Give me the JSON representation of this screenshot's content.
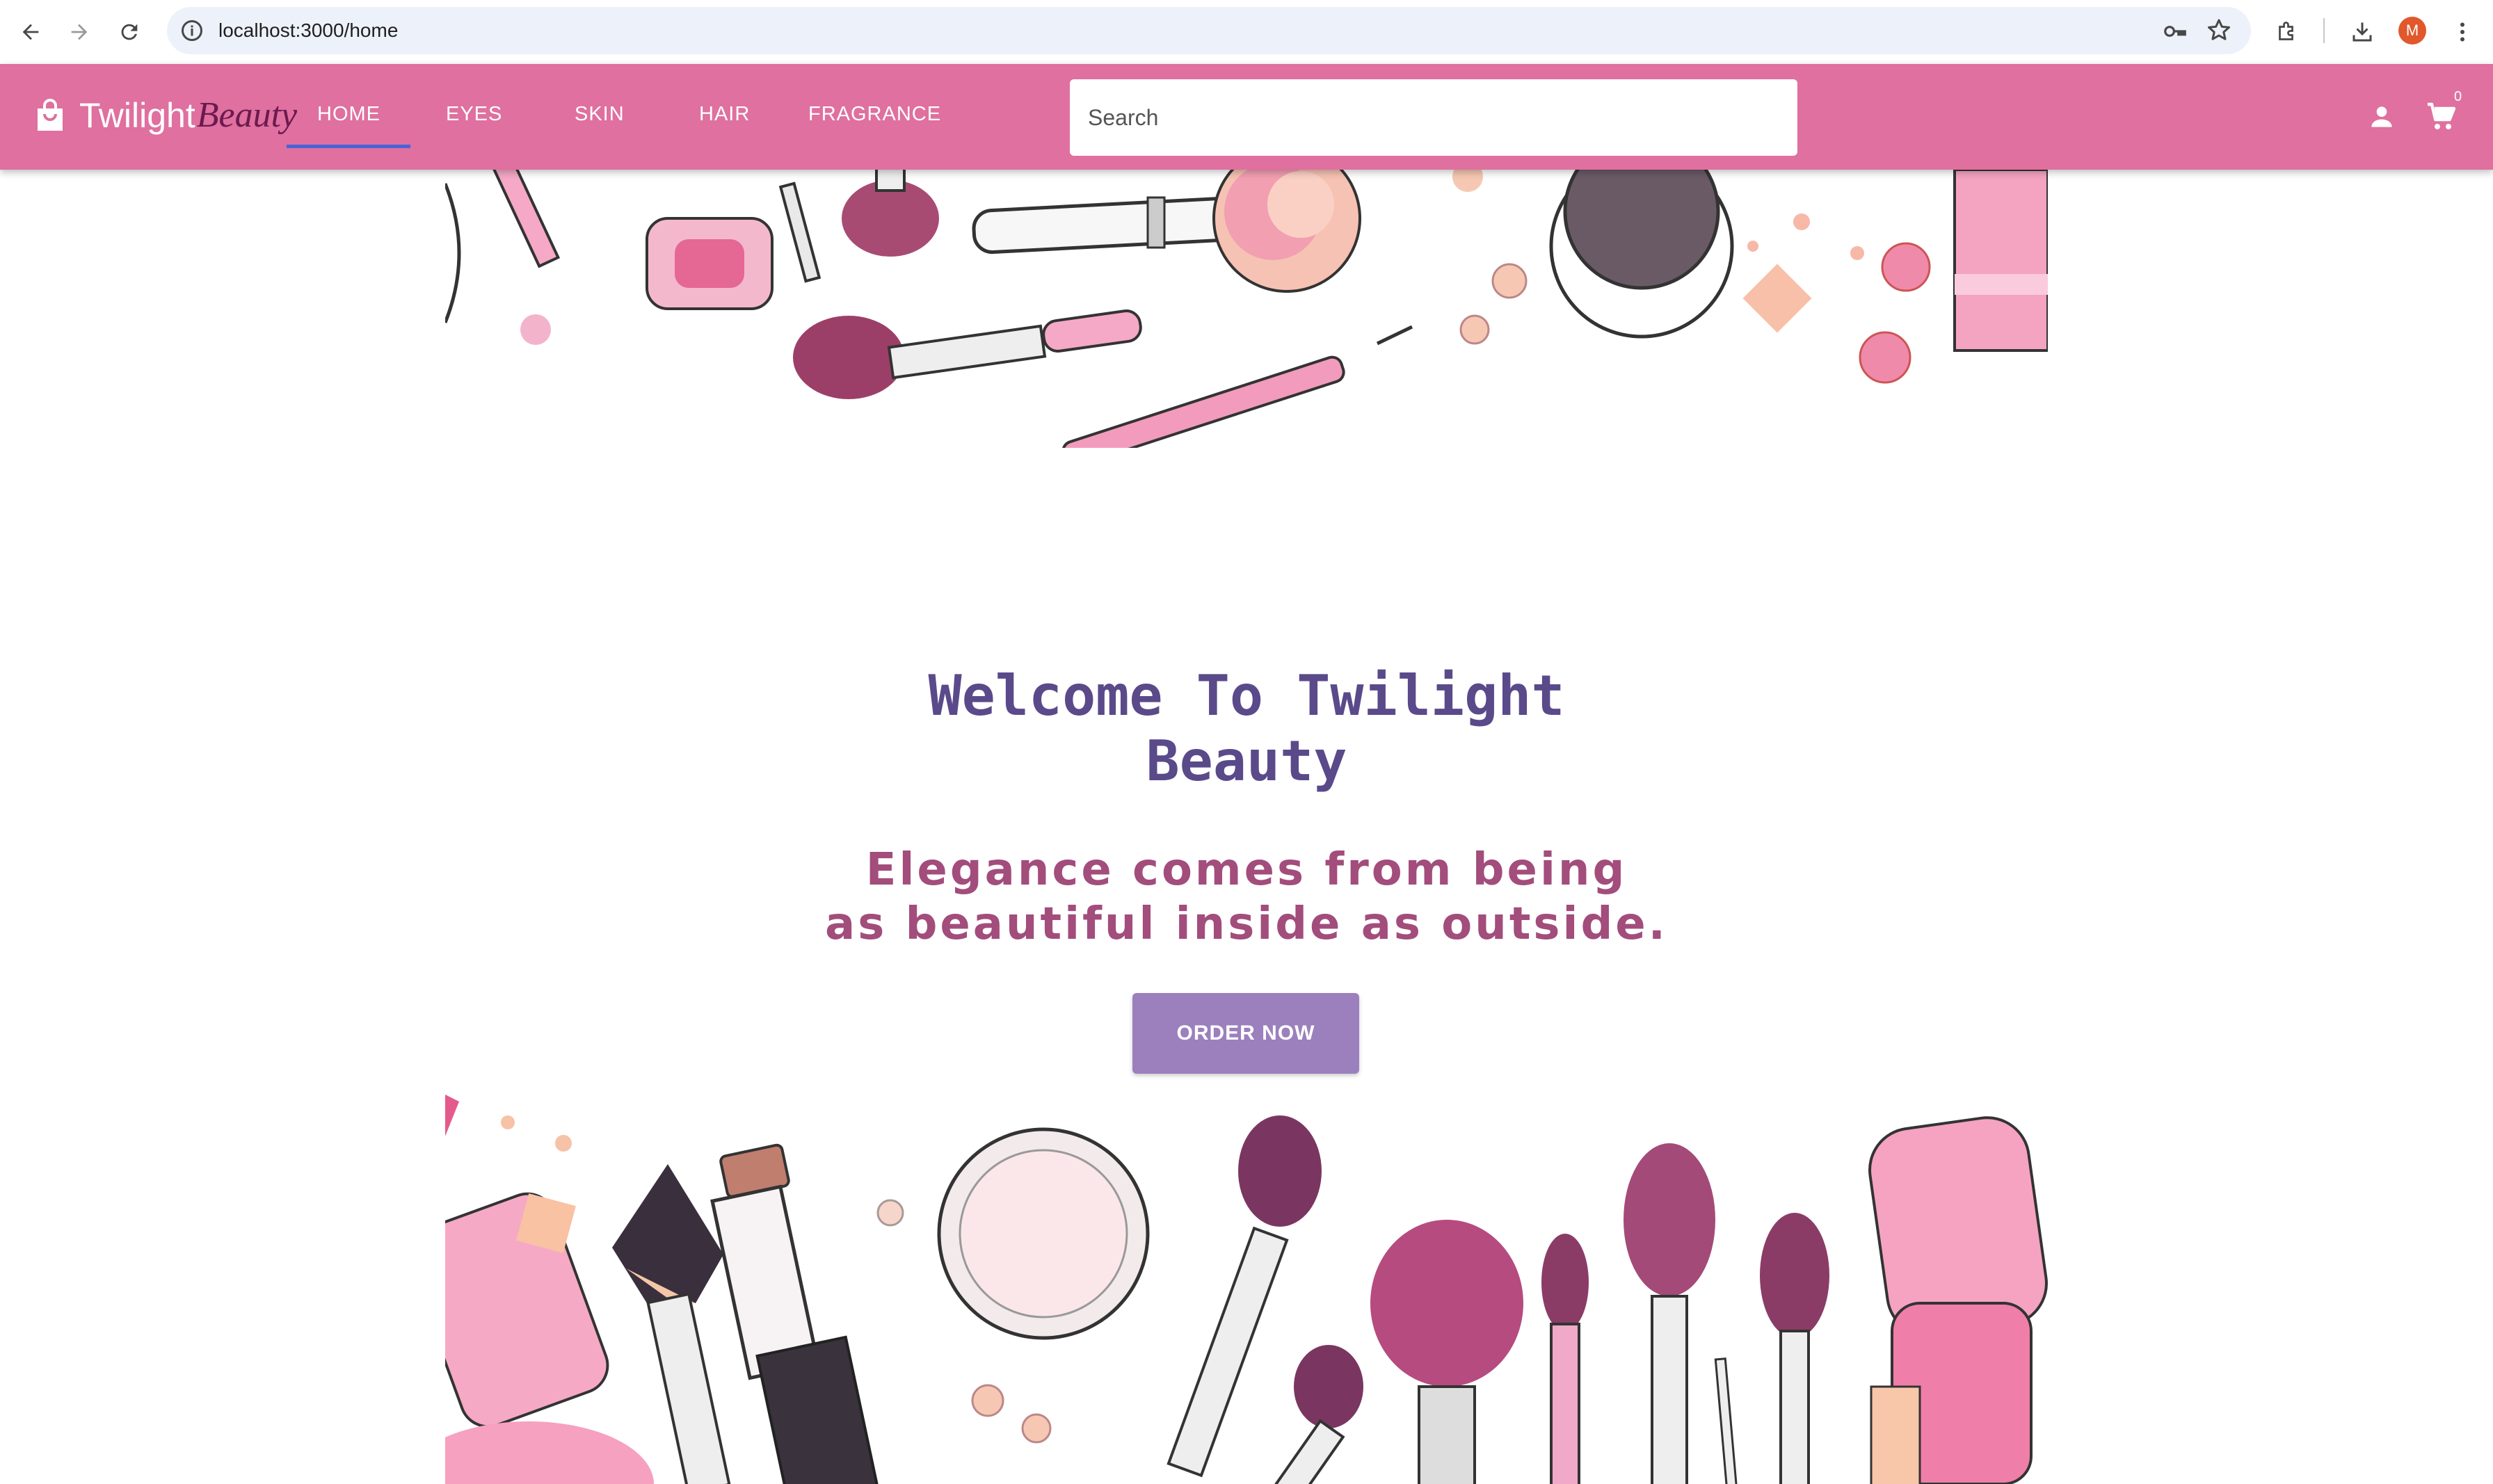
{
  "browser": {
    "url": "localhost:3000/home",
    "profile_initial": "M"
  },
  "appbar": {
    "brand_part1": "Twilight",
    "brand_part2": "Beauty",
    "tabs": [
      {
        "label": "HOME",
        "active": true
      },
      {
        "label": "EYES"
      },
      {
        "label": "SKIN"
      },
      {
        "label": "HAIR"
      },
      {
        "label": "FRAGRANCE"
      }
    ],
    "search_placeholder": "Search",
    "cart_count": "0",
    "color": "#df709f"
  },
  "hero": {
    "title_line1": "Welcome To Twilight",
    "title_line2": "Beauty",
    "tagline_line1": "Elegance comes from being",
    "tagline_line2": "as beautiful inside as outside.",
    "cta_label": "ORDER NOW",
    "title_color": "#5a4a8a",
    "tagline_color": "#a24d7c",
    "cta_color": "#9b80bd"
  },
  "icons": [
    "back-arrow-icon",
    "forward-arrow-icon",
    "reload-icon",
    "site-info-icon",
    "password-key-icon",
    "bookmark-star-icon",
    "extensions-icon",
    "download-icon",
    "more-menu-icon",
    "shopping-bag-icon",
    "account-icon",
    "shopping-cart-icon"
  ]
}
